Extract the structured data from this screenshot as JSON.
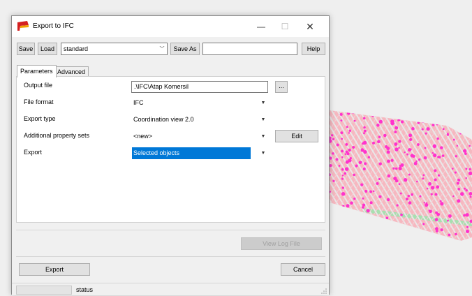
{
  "window": {
    "title": "Export to IFC",
    "min_glyph": "—",
    "max_glyph": "☐",
    "close_glyph": "✕"
  },
  "toolbar": {
    "save_label": "Save",
    "load_label": "Load",
    "preset_value": "standard",
    "save_as_label": "Save As",
    "save_as_name_value": "",
    "help_label": "Help"
  },
  "tabs": [
    {
      "label": "Parameters",
      "active": true
    },
    {
      "label": "Advanced",
      "active": false
    }
  ],
  "form": {
    "output_file": {
      "label": "Output file",
      "value": ".\\IFC\\Atap Komersil",
      "browse_label": "..."
    },
    "file_format": {
      "label": "File format",
      "value": "IFC"
    },
    "export_type": {
      "label": "Export type",
      "value": "Coordination view 2.0"
    },
    "additional_property_sets": {
      "label": "Additional property sets",
      "value": "<new>",
      "edit_label": "Edit"
    },
    "export": {
      "label": "Export",
      "value": "Selected objects"
    }
  },
  "view_log_label": "View Log File",
  "footer": {
    "export_label": "Export",
    "cancel_label": "Cancel"
  },
  "status": {
    "text": "status"
  },
  "colors": {
    "selection": "#0078d7",
    "model_members": "#ff33cc",
    "model_slab": "#f4a6b0",
    "model_beam": "#9ed9a8"
  }
}
